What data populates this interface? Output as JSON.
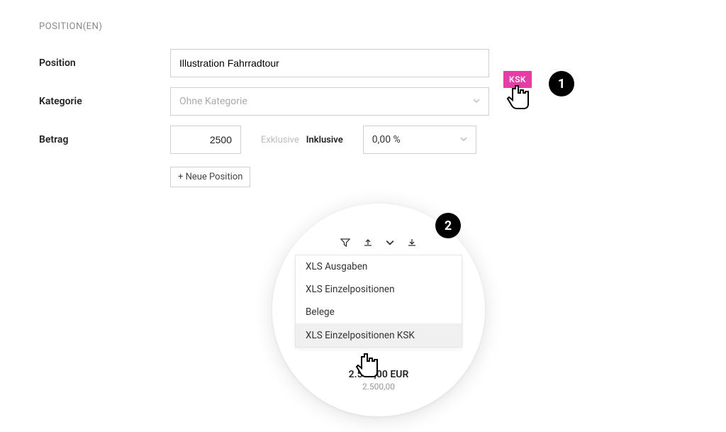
{
  "section_header": "POSITION(EN)",
  "labels": {
    "position": "Position",
    "category": "Kategorie",
    "amount": "Betrag"
  },
  "fields": {
    "position_value": "Illustration Fahrradtour",
    "category_placeholder": "Ohne Kategorie",
    "amount_value": "2500",
    "tax_exclusive": "Exklusive",
    "tax_inclusive": "Inklusive",
    "tax_percent": "0,00 %",
    "add_position": "+ Neue Position"
  },
  "ksk_badge": "KSK",
  "steps": {
    "one": "1",
    "two": "2"
  },
  "menu": {
    "items": [
      "XLS Ausgaben",
      "XLS Einzelpositionen",
      "Belege"
    ],
    "highlight": "XLS Einzelpositionen KSK"
  },
  "totals": {
    "line1": "2.500,00 EUR",
    "line2": "2.500,00"
  }
}
